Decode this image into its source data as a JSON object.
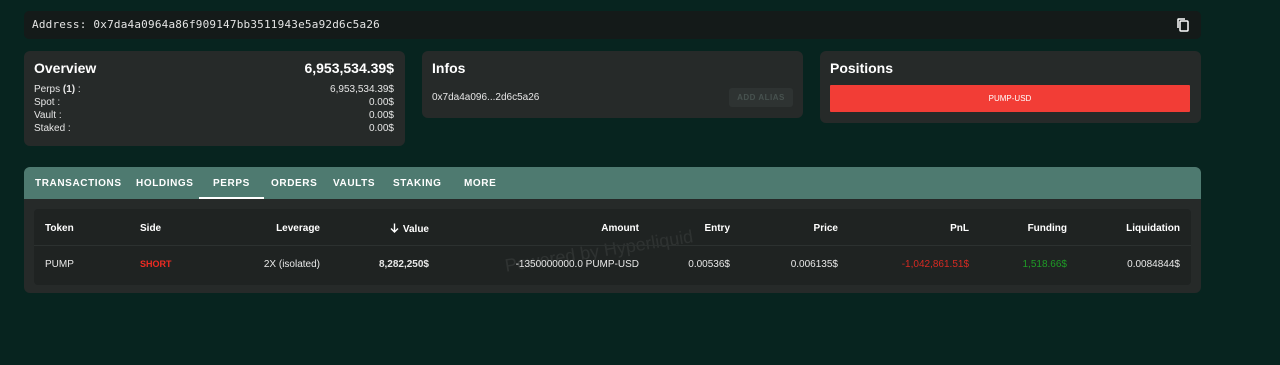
{
  "address_bar": {
    "label": "Address:",
    "address": "0x7da4a0964a86f909147bb3511943e5a92d6c5a26"
  },
  "overview": {
    "title": "Overview",
    "total": "6,953,534.39$",
    "rows": [
      {
        "label_prefix": "Perps ",
        "label_count": "(1)",
        "label_suffix": " :",
        "value": "6,953,534.39$"
      },
      {
        "label": "Spot :",
        "value": "0.00$"
      },
      {
        "label": "Vault :",
        "value": "0.00$"
      },
      {
        "label": "Staked :",
        "value": "0.00$"
      }
    ]
  },
  "infos": {
    "title": "Infos",
    "short_address": "0x7da4a096...2d6c5a26",
    "alias_button": "ADD ALIAS"
  },
  "positions": {
    "title": "Positions",
    "items": [
      "PUMP-USD"
    ],
    "accent_color": "#f23d36"
  },
  "tabs": [
    "TRANSACTIONS",
    "HOLDINGS",
    "PERPS",
    "ORDERS",
    "VAULTS",
    "STAKING",
    "MORE"
  ],
  "active_tab": "PERPS",
  "table": {
    "headers": [
      "Token",
      "Side",
      "Leverage",
      "Value",
      "Amount",
      "Entry",
      "Price",
      "PnL",
      "Funding",
      "Liquidation"
    ],
    "sort_column": "Value",
    "sort_icon": "arrow-down-icon",
    "rows": [
      {
        "token": "PUMP",
        "side": "SHORT",
        "leverage": "2X (isolated)",
        "value": "8,282,250$",
        "amount": "-1350000000.0 PUMP-USD",
        "entry": "0.00536$",
        "price": "0.006135$",
        "pnl": "-1,042,861.51$",
        "funding": "1,518.66$",
        "liquidation": "0.0084844$"
      }
    ]
  },
  "watermark": "Powered by Hyperliquid",
  "colors": {
    "background": "#07241f",
    "tab_bar": "#4e7a70",
    "short": "#ee2b23",
    "negative": "#d62a23",
    "positive": "#1f9b26"
  }
}
